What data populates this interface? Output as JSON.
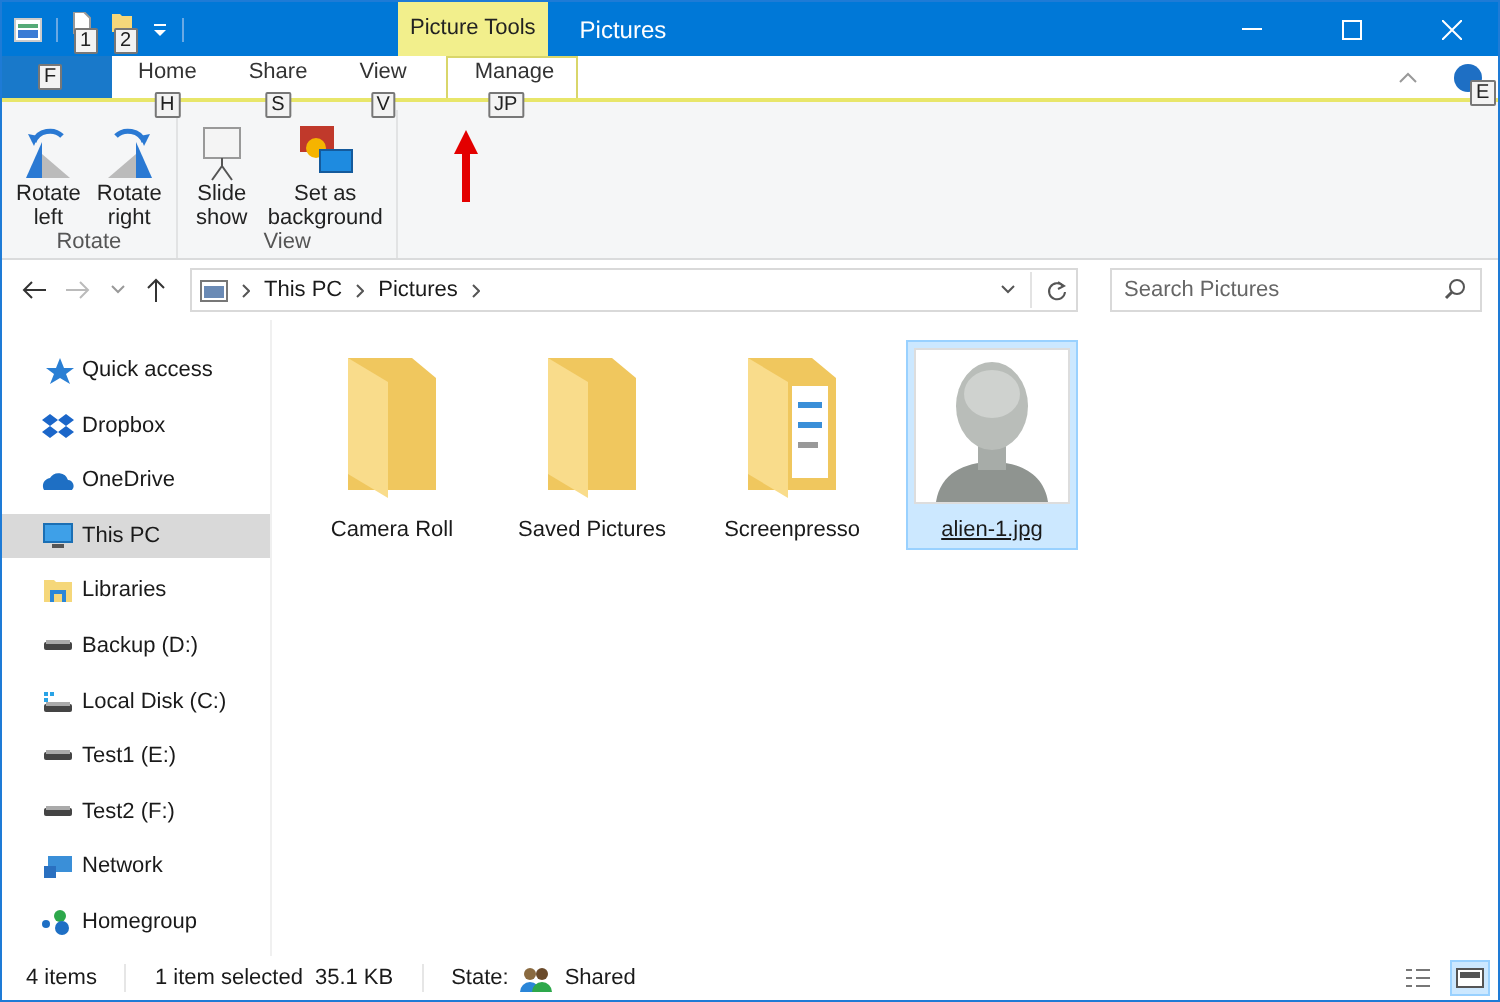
{
  "title_bar": {
    "quick_access_keytips": [
      "1",
      "2"
    ],
    "contextual_tab": "Picture Tools",
    "title": "Pictures"
  },
  "file_tab": {
    "keytip": "F"
  },
  "tabs": [
    {
      "label": "Home",
      "keytip": "H",
      "selected": false
    },
    {
      "label": "Share",
      "keytip": "S",
      "selected": false
    },
    {
      "label": "View",
      "keytip": "V",
      "selected": false
    },
    {
      "label": "Manage",
      "keytip": "JP",
      "selected": true
    }
  ],
  "help_keytip": "E",
  "ribbon_groups": [
    {
      "name": "Rotate",
      "buttons": [
        {
          "kind": "rotate-left",
          "lines": [
            "Rotate",
            "left"
          ]
        },
        {
          "kind": "rotate-right",
          "lines": [
            "Rotate",
            "right"
          ]
        }
      ]
    },
    {
      "name": "View",
      "buttons": [
        {
          "kind": "slideshow",
          "lines": [
            "Slide",
            "show"
          ]
        },
        {
          "kind": "background",
          "lines": [
            "Set as",
            "background"
          ]
        }
      ]
    }
  ],
  "address_bar": {
    "crumbs": [
      "This PC",
      "Pictures"
    ]
  },
  "search": {
    "placeholder": "Search Pictures"
  },
  "sidebar": {
    "items": [
      {
        "label": "Quick access",
        "kind": "star",
        "selected": false
      },
      {
        "label": "Dropbox",
        "kind": "dropbox",
        "selected": false
      },
      {
        "label": "OneDrive",
        "kind": "cloud",
        "selected": false
      },
      {
        "label": "This PC",
        "kind": "pc",
        "selected": true
      },
      {
        "label": "Libraries",
        "kind": "library",
        "selected": false
      },
      {
        "label": "Backup (D:)",
        "kind": "drive",
        "selected": false
      },
      {
        "label": "Local Disk (C:)",
        "kind": "sysdrive",
        "selected": false
      },
      {
        "label": "Test1 (E:)",
        "kind": "drive",
        "selected": false
      },
      {
        "label": "Test2 (F:)",
        "kind": "drive",
        "selected": false
      },
      {
        "label": "Network",
        "kind": "network",
        "selected": false
      },
      {
        "label": "Homegroup",
        "kind": "homegroup",
        "selected": false
      }
    ]
  },
  "files": [
    {
      "name": "Camera Roll",
      "kind": "folder",
      "selected": false
    },
    {
      "name": "Saved Pictures",
      "kind": "folder",
      "selected": false
    },
    {
      "name": "Screenpresso",
      "kind": "folder-docs",
      "selected": false
    },
    {
      "name": "alien-1.jpg",
      "kind": "picture",
      "selected": true
    }
  ],
  "status_bar": {
    "count": "4 items",
    "selection": "1 item selected",
    "size": "35.1 KB",
    "state_label": "State:",
    "state": "Shared",
    "views": [
      {
        "kind": "details",
        "selected": false
      },
      {
        "kind": "large-icons",
        "selected": true
      }
    ]
  }
}
